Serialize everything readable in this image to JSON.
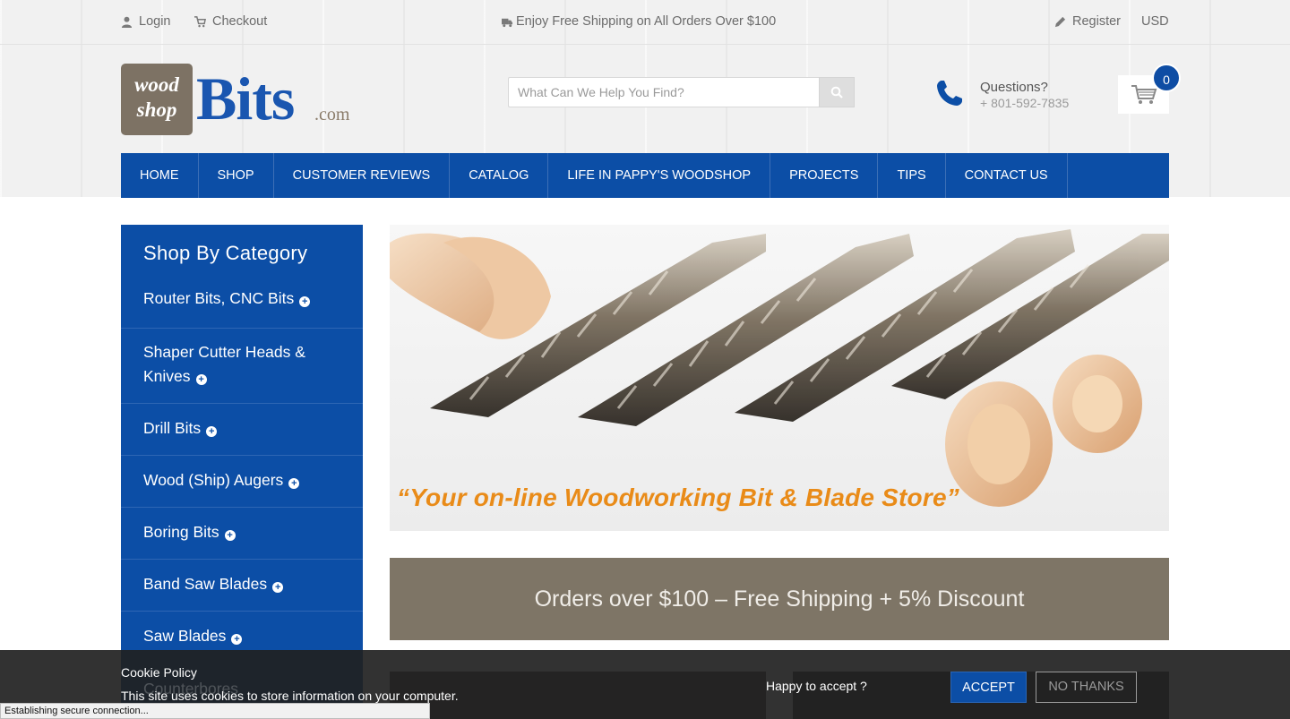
{
  "topbar": {
    "login": "Login",
    "checkout": "Checkout",
    "shipping": "Enjoy Free Shipping on All Orders Over $100",
    "register": "Register",
    "currency": "USD"
  },
  "logo": {
    "wood": "wood",
    "shop": "shop",
    "bits": "Bits",
    "com": ".com"
  },
  "search": {
    "placeholder": "What Can We Help You Find?"
  },
  "contact": {
    "questions": "Questions?",
    "phone": "+ 801-592-7835"
  },
  "cart": {
    "count": "0"
  },
  "nav": [
    "HOME",
    "SHOP",
    "CUSTOMER REVIEWS",
    "CATALOG",
    "LIFE IN PAPPY'S WOODSHOP",
    "PROJECTS",
    "TIPS",
    "CONTACT US"
  ],
  "sidebar": {
    "title": "Shop By Category",
    "categories": [
      {
        "label": "Router Bits, CNC Bits"
      },
      {
        "label": "Shaper Cutter Heads &",
        "label2": "Knives"
      },
      {
        "label": "Drill Bits"
      },
      {
        "label": "Wood (Ship) Augers"
      },
      {
        "label": "Boring Bits"
      },
      {
        "label": "Band Saw Blades"
      },
      {
        "label": "Saw Blades"
      },
      {
        "label": "Counterbores"
      }
    ]
  },
  "hero": {
    "tagline": "“Your on-line Woodworking Bit & Blade Store”"
  },
  "promo": {
    "text": "Orders over $100 – Free Shipping + 5% Discount"
  },
  "cookie": {
    "title": "Cookie Policy",
    "text": "This site uses cookies to store information on your computer.",
    "question": "Happy to accept ?",
    "accept": "ACCEPT",
    "decline": "NO THANKS"
  },
  "status": "Establishing secure connection...",
  "colors": {
    "brand_blue": "#0c4ea6",
    "brand_brown": "#7e7566",
    "tagline_orange": "#e98b18"
  }
}
